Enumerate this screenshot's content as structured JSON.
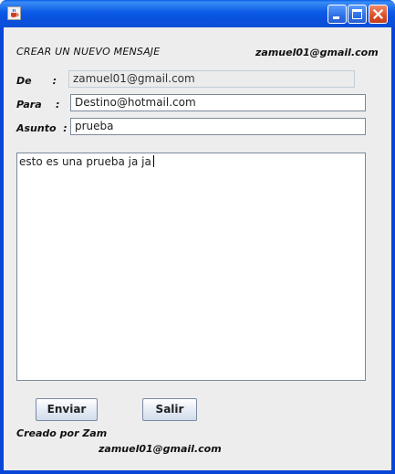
{
  "window": {
    "title": "",
    "icons": {
      "app": "java-coffee-icon",
      "minimize": "minimize-icon",
      "maximize": "maximize-icon",
      "close": "close-icon"
    },
    "colors": {
      "titlebar": "#0a50dc",
      "client": "#ededed",
      "close_button": "#d9502a"
    }
  },
  "header": {
    "title": "CREAR UN NUEVO MENSAJE",
    "email": "zamuel01@gmail.com"
  },
  "form": {
    "de": {
      "label": "De      :",
      "value": "zamuel01@gmail.com"
    },
    "para": {
      "label": "Para    :",
      "value": "Destino@hotmail.com"
    },
    "asunto": {
      "label": "Asunto  :",
      "value": "prueba"
    },
    "body": {
      "value": "esto es una prueba ja ja"
    }
  },
  "buttons": {
    "send": "Enviar",
    "exit": "Salir"
  },
  "footer": {
    "credit": "Creado por Zam",
    "email": "zamuel01@gmail.com"
  }
}
